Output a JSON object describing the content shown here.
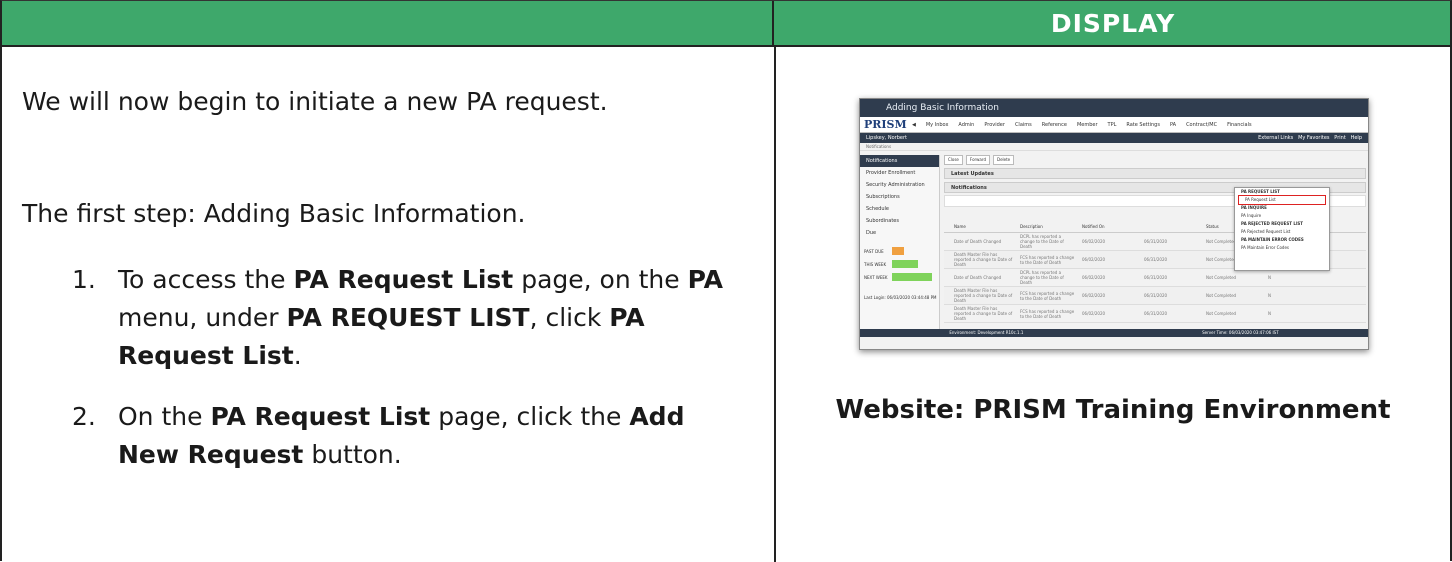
{
  "header": {
    "display_label": "DISPLAY"
  },
  "instructions": {
    "intro": "We will now begin to initiate a new PA request.",
    "first_step": "The first step: Adding Basic Information.",
    "steps": [
      {
        "num": "1.",
        "parts": [
          "To access the ",
          "PA Request List",
          " page, on the ",
          "PA",
          " menu, under ",
          "PA REQUEST LIST",
          ", click ",
          "PA Request List",
          "."
        ]
      },
      {
        "num": "2.",
        "parts": [
          "On the ",
          "PA Request List",
          " page, click the ",
          "Add New Request",
          " button."
        ]
      }
    ]
  },
  "screenshot": {
    "title": "Adding Basic Information",
    "logo": "PRISM",
    "nav": [
      "My Inbox",
      "Admin",
      "Provider",
      "Claims",
      "Reference",
      "Member",
      "TPL",
      "Rate Settings",
      "PA",
      "Contract/MC",
      "Financials"
    ],
    "user": "Lipskey, Norbert",
    "bar_links": [
      "External Links",
      "My Favorites",
      "Print",
      "Help"
    ],
    "crumb": "Notifications",
    "sidebar": [
      "Notifications",
      "Provider Enrollment",
      "Security Administration",
      "Subscriptions",
      "Schedule",
      "Subordinates",
      "Due"
    ],
    "chart_labels": [
      "PAST DUE",
      "THIS WEEK",
      "NEXT WEEK"
    ],
    "last_login": "Last Login: 06/03/2020 03:44:48 PM",
    "toolbar": [
      "Close",
      "Forward",
      "Delete"
    ],
    "panels": [
      "Latest Updates",
      "Notifications"
    ],
    "dropdown": [
      "PA REQUEST LIST",
      "PA Request List",
      "PA INQUIRE",
      "PA Inquire",
      "PA REJECTED REQUEST LIST",
      "PA Rejected Request List",
      "PA MAINTAIN ERROR CODES",
      "PA Maintain Error Codes"
    ],
    "grid_cols": [
      "Name",
      "Description",
      "Notified On",
      "Status",
      "Read"
    ],
    "rows": [
      [
        "Date of Death Changed",
        "DCPL has reported a change to the Date of Death",
        "06/02/2020",
        "06/31/2020",
        "Not Completed",
        "Y"
      ],
      [
        "Death Master File has reported a change to Date of Death",
        "FCS has reported a change to the Date of Death",
        "06/02/2020",
        "06/31/2020",
        "Not Completed",
        "N"
      ],
      [
        "Date of Death Changed",
        "DCPL has reported a change to the Date of Death",
        "06/02/2020",
        "06/31/2020",
        "Not Completed",
        "N"
      ],
      [
        "Death Master File has reported a change to Date of Death",
        "FCS has reported a change to the Date of Death",
        "06/02/2020",
        "06/31/2020",
        "Not Completed",
        "N"
      ],
      [
        "Death Master File has reported a change to Date of Death",
        "FCS has reported a change to the Date of Death",
        "06/02/2020",
        "06/31/2020",
        "Not Completed",
        "N"
      ]
    ],
    "status_env": "Environment: Development R10c.1.1",
    "status_time": "Server Time: 06/03/2020 03:47:06 IST"
  },
  "caption": "Website: PRISM Training Environment",
  "colors": {
    "header_green": "#3ea86b",
    "screenshot_dark": "#2f3c4e"
  }
}
